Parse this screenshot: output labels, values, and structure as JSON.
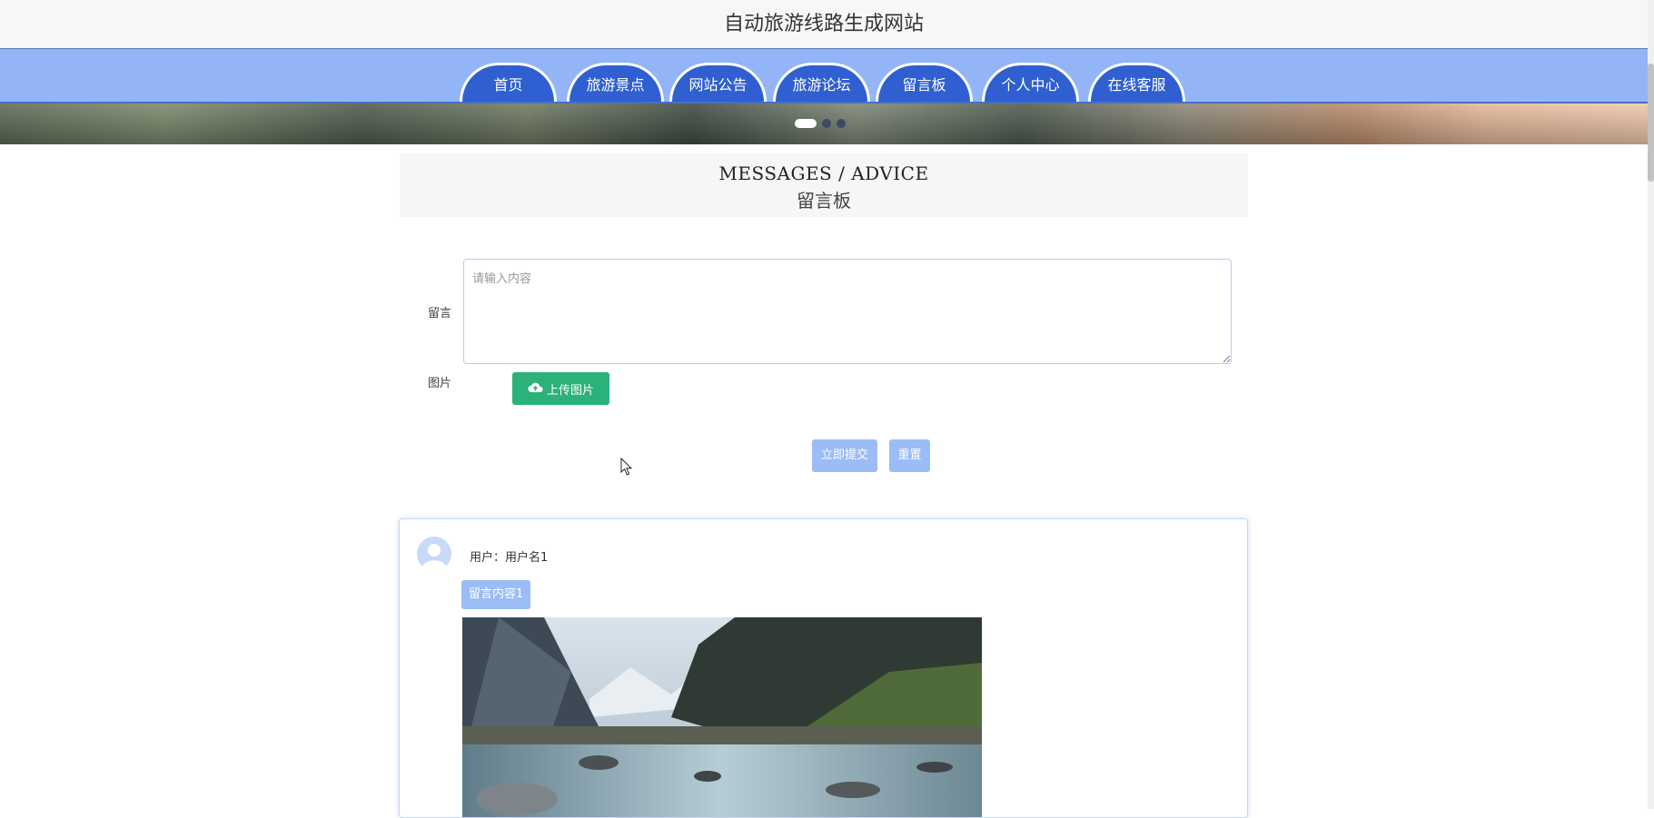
{
  "header": {
    "title": "自动旅游线路生成网站"
  },
  "nav": {
    "items": [
      {
        "label": "首页"
      },
      {
        "label": "旅游景点"
      },
      {
        "label": "网站公告"
      },
      {
        "label": "旅游论坛"
      },
      {
        "label": "留言板"
      },
      {
        "label": "个人中心"
      },
      {
        "label": "在线客服"
      }
    ]
  },
  "carousel": {
    "slide_count": 3,
    "active_index": 0
  },
  "section": {
    "title_en": "MESSAGES / ADVICE",
    "title_cn": "留言板"
  },
  "form": {
    "message_label": "留言",
    "message_placeholder": "请输入内容",
    "message_value": "",
    "image_label": "图片",
    "upload_label": "上传图片",
    "submit_label": "立即提交",
    "reset_label": "重置"
  },
  "messages": [
    {
      "user_line": "用户：用户名1",
      "content": "留言内容1",
      "has_image": true
    }
  ],
  "icons": {
    "upload": "cloud-upload-icon",
    "avatar": "user-avatar-icon"
  },
  "colors": {
    "nav_bg": "#93b4f6",
    "nav_tab": "#2f5fd0",
    "upload_button": "#2bb17a",
    "light_button": "#9bbcf7"
  }
}
